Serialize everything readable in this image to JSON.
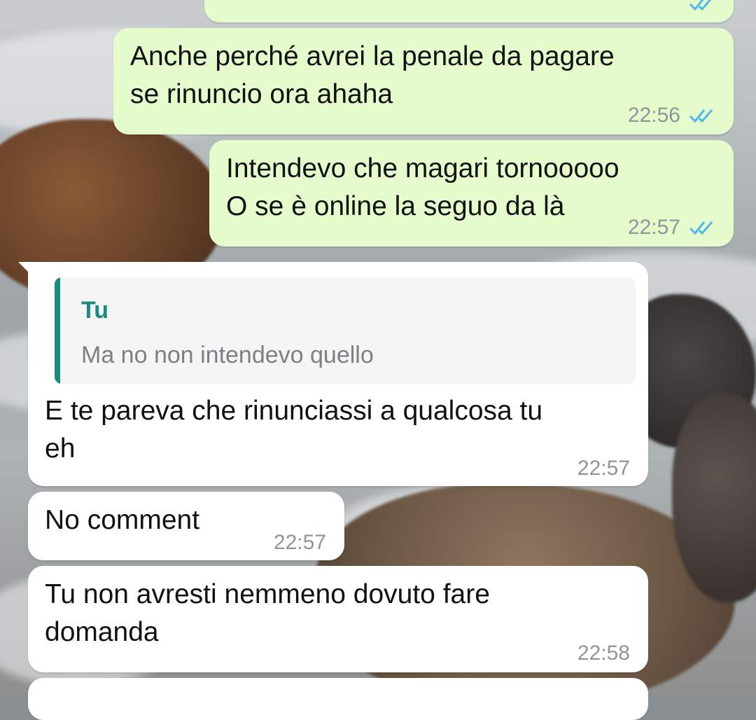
{
  "chat": {
    "messages": [
      {
        "direction": "outgoing",
        "text": "",
        "time": "",
        "status": "read"
      },
      {
        "direction": "outgoing",
        "text": "Anche perché avrei la penale da pagare\nse rinuncio ora ahaha",
        "time": "22:56",
        "status": "read"
      },
      {
        "direction": "outgoing",
        "text": "Intendevo che magari tornooooo\nO se è online la seguo da là",
        "time": "22:57",
        "status": "read"
      },
      {
        "direction": "incoming",
        "quote": {
          "author": "Tu",
          "text": "Ma no non intendevo quello"
        },
        "text": "E te pareva che rinunciassi a qualcosa tu\neh",
        "time": "22:57"
      },
      {
        "direction": "incoming",
        "text": "No comment",
        "time": "22:57"
      },
      {
        "direction": "incoming",
        "text": "Tu non avresti nemmeno dovuto fare\ndomanda",
        "time": "22:58"
      },
      {
        "direction": "incoming",
        "text": "",
        "time": ""
      }
    ]
  },
  "colors": {
    "outgoing_bubble": "#e5fbcb",
    "incoming_bubble": "#ffffff",
    "read_ticks": "#4fb6ec",
    "quote_accent": "#178c7e",
    "timestamp": "#8d9698"
  },
  "icons": {
    "read_receipt": "double-check-icon"
  }
}
